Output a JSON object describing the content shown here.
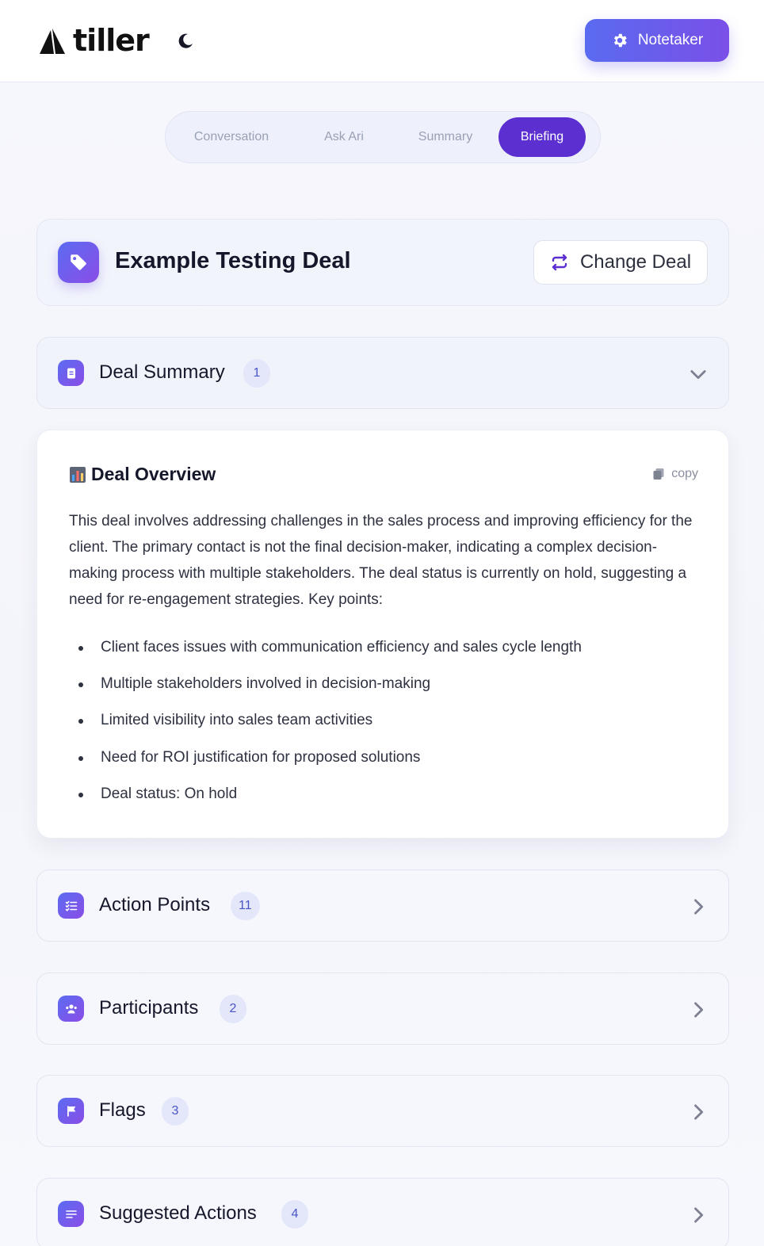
{
  "header": {
    "logo_text": "tiller",
    "notetaker_label": "Notetaker"
  },
  "tabs": [
    {
      "label": "Conversation",
      "active": false
    },
    {
      "label": "Ask Ari",
      "active": false
    },
    {
      "label": "Summary",
      "active": false
    },
    {
      "label": "Briefing",
      "active": true
    }
  ],
  "deal": {
    "title": "Example Testing Deal",
    "change_label": "Change Deal"
  },
  "sections": {
    "deal_summary": {
      "title": "Deal Summary",
      "count": "1",
      "expanded": true
    },
    "action_points": {
      "title": "Action Points",
      "count": "11"
    },
    "participants": {
      "title": "Participants",
      "count": "2"
    },
    "flags": {
      "title": "Flags",
      "count": "3"
    },
    "suggested_actions": {
      "title": "Suggested Actions",
      "count": "4"
    }
  },
  "overview": {
    "title": "Deal Overview",
    "copy_label": "copy",
    "text": "This deal involves addressing challenges in the sales process and improving efficiency for the client. The primary contact is not the final decision-maker, indicating a complex decision-making process with multiple stakeholders. The deal status is currently on hold, suggesting a need for re-engagement strategies. Key points:",
    "points": [
      "Client faces issues with communication efficiency and sales cycle length",
      "Multiple stakeholders involved in decision-making",
      "Limited visibility into sales team activities",
      "Need for ROI justification for proposed solutions",
      "Deal status: On hold"
    ]
  },
  "colors": {
    "accent": "#5b2fd0",
    "gradient_start": "#5a6bf0",
    "gradient_end": "#7a4fe8",
    "badge_bg": "#e3e7f9"
  },
  "icons": {
    "logo": "sail-logo-icon",
    "theme": "moon-icon",
    "notetaker": "gear-icon",
    "deal": "tag-icon",
    "change": "swap-arrows-icon",
    "deal_summary": "document-icon",
    "action_points": "checklist-icon",
    "participants": "users-icon",
    "flags": "flag-icon",
    "suggested_actions": "list-icon",
    "overview": "bar-chart-icon",
    "copy": "copy-icon"
  }
}
